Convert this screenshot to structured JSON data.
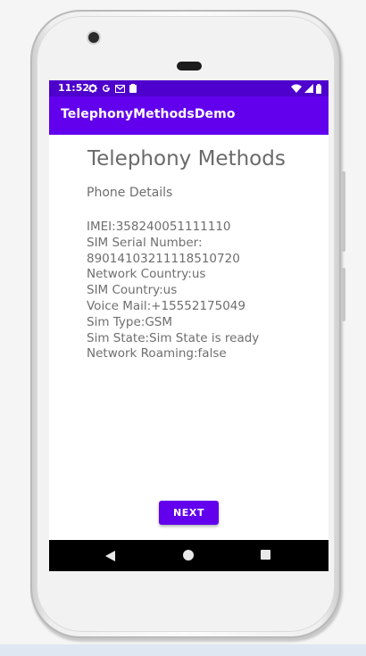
{
  "status_bar": {
    "time": "11:52",
    "icons": [
      "gear-icon",
      "google-icon",
      "gmail-icon",
      "clipboard-icon"
    ],
    "right_icons": [
      "wifi-icon",
      "signal-icon",
      "battery-icon"
    ],
    "color": "#4e00cc"
  },
  "app_bar": {
    "title": "TelephonyMethodsDemo",
    "color": "#6200ee"
  },
  "main": {
    "title": "Telephony Methods",
    "section_label": "Phone Details",
    "details": [
      "IMEI:358240051111110",
      "SIM Serial Number:",
      "89014103211118510720",
      "Network Country:us",
      "SIM Country:us",
      "Voice Mail:+15552175049",
      "Sim Type:GSM",
      "Sim State:Sim State is ready",
      "Network Roaming:false"
    ],
    "next_label": "NEXT"
  },
  "nav_bar": {
    "icons": [
      "back-icon",
      "home-icon",
      "recents-icon"
    ]
  }
}
